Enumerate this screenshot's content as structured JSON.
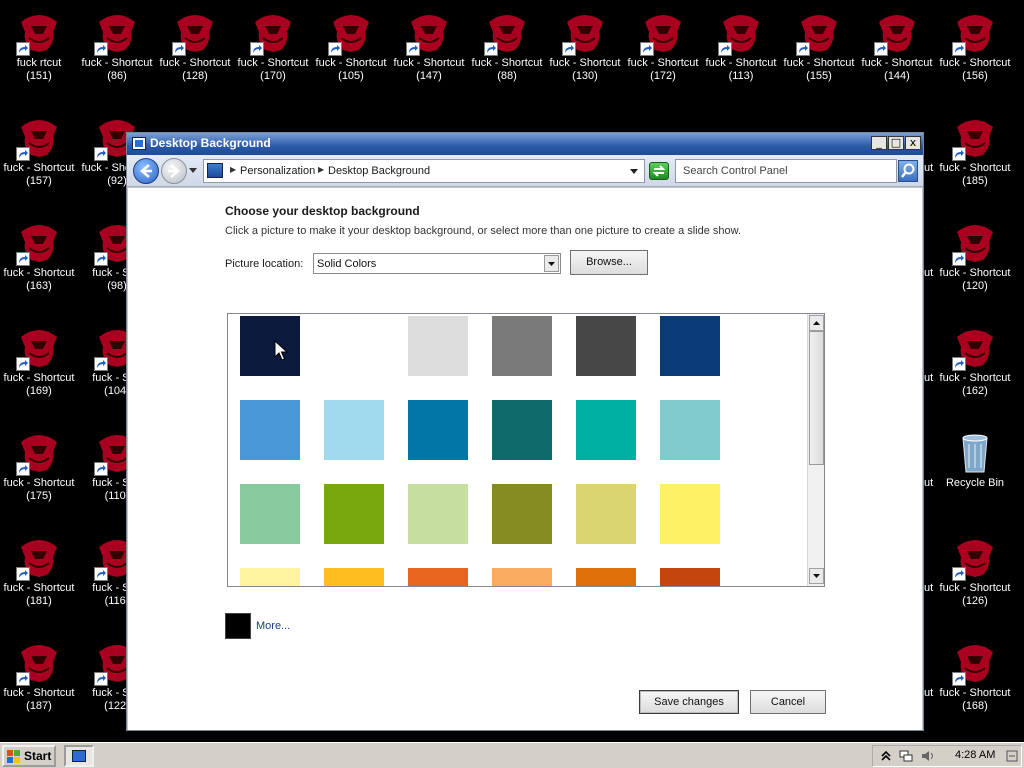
{
  "desktop": {
    "top_row_labels": [
      [
        "fuck rtcut",
        "(151)"
      ],
      [
        "fuck - Shortcut",
        "(86)"
      ],
      [
        "fuck - Shortcut",
        "(128)"
      ],
      [
        "fuck - Shortcut",
        "(170)"
      ],
      [
        "fuck - Shortcut",
        "(105)"
      ],
      [
        "fuck - Shortcut",
        "(147)"
      ],
      [
        "fuck - Shortcut",
        "(88)"
      ],
      [
        "fuck - Shortcut",
        "(130)"
      ],
      [
        "fuck - Shortcut",
        "(172)"
      ],
      [
        "fuck - Shortcut",
        "(113)"
      ],
      [
        "fuck - Shortcut",
        "(155)"
      ],
      [
        "fuck - Shortcut",
        "(144)"
      ],
      [
        "fuck - Shortcut",
        "(156)"
      ]
    ],
    "left_col1": [
      [
        "fuck - Shortcut",
        "(157)"
      ],
      [
        "fuck - Shortcut",
        "(163)"
      ],
      [
        "fuck - Shortcut",
        "(169)"
      ],
      [
        "fuck - Shortcut",
        "(175)"
      ],
      [
        "fuck - Shortcut",
        "(181)"
      ],
      [
        "fuck - Shortcut",
        "(187)"
      ]
    ],
    "left_col2": [
      [
        "fuck - Shortcut",
        "(92)"
      ],
      [
        "fuck - Sho",
        "(98)"
      ],
      [
        "fuck - Sho",
        "(104)"
      ],
      [
        "fuck - Sho",
        "(110)"
      ],
      [
        "fuck - Sho",
        "(116)"
      ],
      [
        "fuck - Sho",
        "(122)"
      ]
    ],
    "right_col_partial": [
      "ut",
      "ut",
      "ut",
      "ut",
      "ut",
      "ut"
    ],
    "right_col": [
      [
        "fuck - Shortcut",
        "(185)"
      ],
      [
        "fuck - Shortcut",
        "(120)"
      ],
      [
        "fuck - Shortcut",
        "(162)"
      ],
      [
        "Recycle Bin",
        ""
      ],
      [
        "fuck - Shortcut",
        "(126)"
      ],
      [
        "fuck - Shortcut",
        "(168)"
      ]
    ]
  },
  "window": {
    "title": "Desktop Background",
    "controls": {
      "minimize": "_",
      "maximize": "□",
      "close": "x"
    },
    "breadcrumb": [
      "Personalization",
      "Desktop Background"
    ],
    "search_placeholder": "Search Control Panel",
    "heading": "Choose your desktop background",
    "subtext": "Click a picture to make it your desktop background, or select more than one picture to create a slide show.",
    "picture_location_label": "Picture location:",
    "picture_location_value": "Solid Colors",
    "browse_label": "Browse...",
    "swatch_colors": [
      "#0c1a3e",
      "#ffffff",
      "#dcdcdc",
      "#7a7a7a",
      "#474747",
      "#0b3a78",
      "#4a98d8",
      "#a1daee",
      "#0077a6",
      "#0f6b6b",
      "#00b0a3",
      "#7fcbc9",
      "#88ca9e",
      "#78a80e",
      "#c4df9e",
      "#868b1f",
      "#dad570",
      "#fdf264",
      "#fff4a0",
      "#ffbe1f",
      "#e8651f",
      "#f8ab5e",
      "#e0700a",
      "#c4460e"
    ],
    "more_label": "More...",
    "more_color": "#000000",
    "save_label": "Save changes",
    "cancel_label": "Cancel"
  },
  "taskbar": {
    "start_label": "Start",
    "clock": "4:28 AM"
  },
  "colors": {
    "titlebar": "#2a5aa8",
    "desktop_bg": "#000000",
    "icon_red": "#a8001e"
  }
}
